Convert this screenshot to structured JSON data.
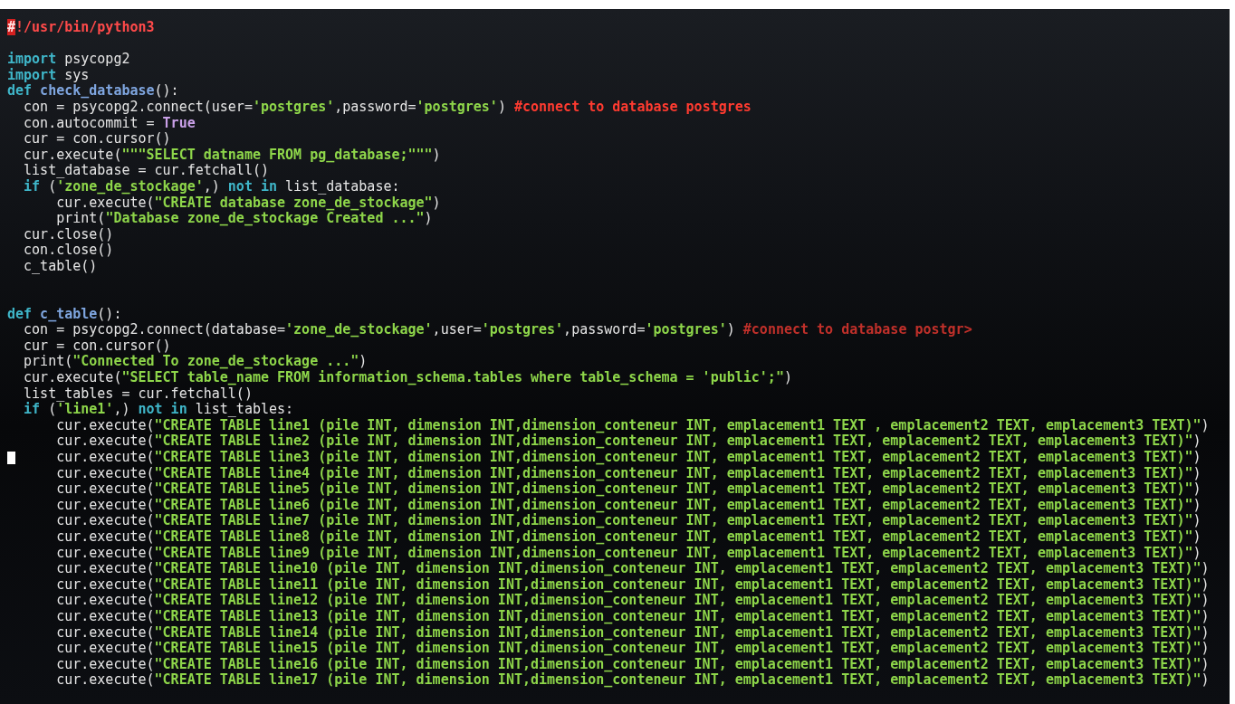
{
  "editor": {
    "lines": [
      {
        "kind": "code",
        "cursor": false,
        "segments": [
          {
            "kind": "mark",
            "t": "#"
          },
          {
            "kind": "shebang",
            "t": "!/usr/bin/python3"
          }
        ]
      },
      {
        "kind": "blank",
        "cursor": false
      },
      {
        "kind": "code",
        "cursor": false,
        "segments": [
          {
            "kind": "kw",
            "t": "import"
          },
          {
            "kind": "plain",
            "t": " psycopg2"
          }
        ]
      },
      {
        "kind": "code",
        "cursor": false,
        "segments": [
          {
            "kind": "kw",
            "t": "import"
          },
          {
            "kind": "plain",
            "t": " sys"
          }
        ]
      },
      {
        "kind": "code",
        "cursor": false,
        "segments": [
          {
            "kind": "kw",
            "t": "def"
          },
          {
            "kind": "fn",
            "t": " check_database"
          },
          {
            "kind": "plain",
            "t": "():"
          }
        ]
      },
      {
        "kind": "code",
        "cursor": false,
        "segments": [
          {
            "kind": "plain",
            "t": "  con = psycopg2.connect(user="
          },
          {
            "kind": "str",
            "t": "'postgres'"
          },
          {
            "kind": "plain",
            "t": ",password="
          },
          {
            "kind": "str",
            "t": "'postgres'"
          },
          {
            "kind": "plain",
            "t": ") "
          },
          {
            "kind": "comment",
            "t": "#connect to database postgres"
          }
        ]
      },
      {
        "kind": "code",
        "cursor": false,
        "segments": [
          {
            "kind": "plain",
            "t": "  con.autocommit = "
          },
          {
            "kind": "const",
            "t": "True"
          }
        ]
      },
      {
        "kind": "code",
        "cursor": false,
        "segments": [
          {
            "kind": "plain",
            "t": "  cur = con.cursor()"
          }
        ]
      },
      {
        "kind": "code",
        "cursor": false,
        "segments": [
          {
            "kind": "plain",
            "t": "  cur.execute("
          },
          {
            "kind": "str",
            "t": "\"\"\"SELECT datname FROM pg_database;\"\"\""
          },
          {
            "kind": "plain",
            "t": ")"
          }
        ]
      },
      {
        "kind": "code",
        "cursor": false,
        "segments": [
          {
            "kind": "plain",
            "t": "  list_database = cur.fetchall()"
          }
        ]
      },
      {
        "kind": "code",
        "cursor": false,
        "segments": [
          {
            "kind": "kw",
            "t": "  if"
          },
          {
            "kind": "plain",
            "t": " ("
          },
          {
            "kind": "str",
            "t": "'zone_de_stockage'"
          },
          {
            "kind": "plain",
            "t": ",) "
          },
          {
            "kind": "kw",
            "t": "not in"
          },
          {
            "kind": "plain",
            "t": " list_database:"
          }
        ]
      },
      {
        "kind": "code",
        "cursor": false,
        "segments": [
          {
            "kind": "plain",
            "t": "      cur.execute("
          },
          {
            "kind": "str",
            "t": "\"CREATE database zone_de_stockage\""
          },
          {
            "kind": "plain",
            "t": ")"
          }
        ]
      },
      {
        "kind": "code",
        "cursor": false,
        "segments": [
          {
            "kind": "plain",
            "t": "      print("
          },
          {
            "kind": "str",
            "t": "\"Database zone_de_stockage Created ...\""
          },
          {
            "kind": "plain",
            "t": ")"
          }
        ]
      },
      {
        "kind": "code",
        "cursor": false,
        "segments": [
          {
            "kind": "plain",
            "t": "  cur.close()"
          }
        ]
      },
      {
        "kind": "code",
        "cursor": false,
        "segments": [
          {
            "kind": "plain",
            "t": "  con.close()"
          }
        ]
      },
      {
        "kind": "code",
        "cursor": false,
        "segments": [
          {
            "kind": "plain",
            "t": "  c_table()"
          }
        ]
      },
      {
        "kind": "blank",
        "cursor": false
      },
      {
        "kind": "blank",
        "cursor": false
      },
      {
        "kind": "code",
        "cursor": false,
        "segments": [
          {
            "kind": "kw",
            "t": "def"
          },
          {
            "kind": "fn",
            "t": " c_table"
          },
          {
            "kind": "plain",
            "t": "():"
          }
        ]
      },
      {
        "kind": "code",
        "cursor": false,
        "segments": [
          {
            "kind": "plain",
            "t": "  con = psycopg2.connect(database="
          },
          {
            "kind": "str",
            "t": "'zone_de_stockage'"
          },
          {
            "kind": "plain",
            "t": ",user="
          },
          {
            "kind": "str",
            "t": "'postgres'"
          },
          {
            "kind": "plain",
            "t": ",password="
          },
          {
            "kind": "str",
            "t": "'postgres'"
          },
          {
            "kind": "plain",
            "t": ") "
          },
          {
            "kind": "comment2",
            "t": "#connect to database postgr>"
          }
        ]
      },
      {
        "kind": "code",
        "cursor": false,
        "segments": [
          {
            "kind": "plain",
            "t": "  cur = con.cursor()"
          }
        ]
      },
      {
        "kind": "code",
        "cursor": false,
        "segments": [
          {
            "kind": "plain",
            "t": "  print("
          },
          {
            "kind": "str",
            "t": "\"Connected To zone_de_stockage ...\""
          },
          {
            "kind": "plain",
            "t": ")"
          }
        ]
      },
      {
        "kind": "code",
        "cursor": false,
        "segments": [
          {
            "kind": "plain",
            "t": "  cur.execute("
          },
          {
            "kind": "str",
            "t": "\"SELECT table_name FROM information_schema.tables where table_schema = 'public';\""
          },
          {
            "kind": "plain",
            "t": ")"
          }
        ]
      },
      {
        "kind": "code",
        "cursor": false,
        "segments": [
          {
            "kind": "plain",
            "t": "  list_tables = cur.fetchall()"
          }
        ]
      },
      {
        "kind": "code",
        "cursor": false,
        "segments": [
          {
            "kind": "kw",
            "t": "  if"
          },
          {
            "kind": "plain",
            "t": " ("
          },
          {
            "kind": "str",
            "t": "'line1'"
          },
          {
            "kind": "plain",
            "t": ",) "
          },
          {
            "kind": "kw",
            "t": "not in"
          },
          {
            "kind": "plain",
            "t": " list_tables:"
          }
        ]
      },
      {
        "kind": "code",
        "cursor": false,
        "segments": [
          {
            "kind": "plain",
            "t": "      cur.execute("
          },
          {
            "kind": "str",
            "t": "\"CREATE TABLE line1 (pile INT, dimension INT,dimension_conteneur INT, emplacement1 TEXT , emplacement2 TEXT, emplacement3 TEXT)\""
          },
          {
            "kind": "plain",
            "t": ")"
          }
        ]
      },
      {
        "kind": "code",
        "cursor": false,
        "segments": [
          {
            "kind": "plain",
            "t": "      cur.execute("
          },
          {
            "kind": "str",
            "t": "\"CREATE TABLE line2 (pile INT, dimension INT,dimension_conteneur INT, emplacement1 TEXT, emplacement2 TEXT, emplacement3 TEXT)\""
          },
          {
            "kind": "plain",
            "t": ")"
          }
        ]
      },
      {
        "kind": "code",
        "cursor": true,
        "segments": [
          {
            "kind": "plain",
            "t": "      cur.execute("
          },
          {
            "kind": "str",
            "t": "\"CREATE TABLE line3 (pile INT, dimension INT,dimension_conteneur INT, emplacement1 TEXT, emplacement2 TEXT, emplacement3 TEXT)\""
          },
          {
            "kind": "plain",
            "t": ")"
          }
        ]
      },
      {
        "kind": "code",
        "cursor": false,
        "segments": [
          {
            "kind": "plain",
            "t": "      cur.execute("
          },
          {
            "kind": "str",
            "t": "\"CREATE TABLE line4 (pile INT, dimension INT,dimension_conteneur INT, emplacement1 TEXT, emplacement2 TEXT, emplacement3 TEXT)\""
          },
          {
            "kind": "plain",
            "t": ")"
          }
        ]
      },
      {
        "kind": "code",
        "cursor": false,
        "segments": [
          {
            "kind": "plain",
            "t": "      cur.execute("
          },
          {
            "kind": "str",
            "t": "\"CREATE TABLE line5 (pile INT, dimension INT,dimension_conteneur INT, emplacement1 TEXT, emplacement2 TEXT, emplacement3 TEXT)\""
          },
          {
            "kind": "plain",
            "t": ")"
          }
        ]
      },
      {
        "kind": "code",
        "cursor": false,
        "segments": [
          {
            "kind": "plain",
            "t": "      cur.execute("
          },
          {
            "kind": "str",
            "t": "\"CREATE TABLE line6 (pile INT, dimension INT,dimension_conteneur INT, emplacement1 TEXT, emplacement2 TEXT, emplacement3 TEXT)\""
          },
          {
            "kind": "plain",
            "t": ")"
          }
        ]
      },
      {
        "kind": "code",
        "cursor": false,
        "segments": [
          {
            "kind": "plain",
            "t": "      cur.execute("
          },
          {
            "kind": "str",
            "t": "\"CREATE TABLE line7 (pile INT, dimension INT,dimension_conteneur INT, emplacement1 TEXT, emplacement2 TEXT, emplacement3 TEXT)\""
          },
          {
            "kind": "plain",
            "t": ")"
          }
        ]
      },
      {
        "kind": "code",
        "cursor": false,
        "segments": [
          {
            "kind": "plain",
            "t": "      cur.execute("
          },
          {
            "kind": "str",
            "t": "\"CREATE TABLE line8 (pile INT, dimension INT,dimension_conteneur INT, emplacement1 TEXT, emplacement2 TEXT, emplacement3 TEXT)\""
          },
          {
            "kind": "plain",
            "t": ")"
          }
        ]
      },
      {
        "kind": "code",
        "cursor": false,
        "segments": [
          {
            "kind": "plain",
            "t": "      cur.execute("
          },
          {
            "kind": "str",
            "t": "\"CREATE TABLE line9 (pile INT, dimension INT,dimension_conteneur INT, emplacement1 TEXT, emplacement2 TEXT, emplacement3 TEXT)\""
          },
          {
            "kind": "plain",
            "t": ")"
          }
        ]
      },
      {
        "kind": "code",
        "cursor": false,
        "segments": [
          {
            "kind": "plain",
            "t": "      cur.execute("
          },
          {
            "kind": "str",
            "t": "\"CREATE TABLE line10 (pile INT, dimension INT,dimension_conteneur INT, emplacement1 TEXT, emplacement2 TEXT, emplacement3 TEXT)\""
          },
          {
            "kind": "plain",
            "t": ")"
          }
        ]
      },
      {
        "kind": "code",
        "cursor": false,
        "segments": [
          {
            "kind": "plain",
            "t": "      cur.execute("
          },
          {
            "kind": "str",
            "t": "\"CREATE TABLE line11 (pile INT, dimension INT,dimension_conteneur INT, emplacement1 TEXT, emplacement2 TEXT, emplacement3 TEXT)\""
          },
          {
            "kind": "plain",
            "t": ")"
          }
        ]
      },
      {
        "kind": "code",
        "cursor": false,
        "segments": [
          {
            "kind": "plain",
            "t": "      cur.execute("
          },
          {
            "kind": "str",
            "t": "\"CREATE TABLE line12 (pile INT, dimension INT,dimension_conteneur INT, emplacement1 TEXT, emplacement2 TEXT, emplacement3 TEXT)\""
          },
          {
            "kind": "plain",
            "t": ")"
          }
        ]
      },
      {
        "kind": "code",
        "cursor": false,
        "segments": [
          {
            "kind": "plain",
            "t": "      cur.execute("
          },
          {
            "kind": "str",
            "t": "\"CREATE TABLE line13 (pile INT, dimension INT,dimension_conteneur INT, emplacement1 TEXT, emplacement2 TEXT, emplacement3 TEXT)\""
          },
          {
            "kind": "plain",
            "t": ")"
          }
        ]
      },
      {
        "kind": "code",
        "cursor": false,
        "segments": [
          {
            "kind": "plain",
            "t": "      cur.execute("
          },
          {
            "kind": "str",
            "t": "\"CREATE TABLE line14 (pile INT, dimension INT,dimension_conteneur INT, emplacement1 TEXT, emplacement2 TEXT, emplacement3 TEXT)\""
          },
          {
            "kind": "plain",
            "t": ")"
          }
        ]
      },
      {
        "kind": "code",
        "cursor": false,
        "segments": [
          {
            "kind": "plain",
            "t": "      cur.execute("
          },
          {
            "kind": "str",
            "t": "\"CREATE TABLE line15 (pile INT, dimension INT,dimension_conteneur INT, emplacement1 TEXT, emplacement2 TEXT, emplacement3 TEXT)\""
          },
          {
            "kind": "plain",
            "t": ")"
          }
        ]
      },
      {
        "kind": "code",
        "cursor": false,
        "segments": [
          {
            "kind": "plain",
            "t": "      cur.execute("
          },
          {
            "kind": "str",
            "t": "\"CREATE TABLE line16 (pile INT, dimension INT,dimension_conteneur INT, emplacement1 TEXT, emplacement2 TEXT, emplacement3 TEXT)\""
          },
          {
            "kind": "plain",
            "t": ")"
          }
        ]
      },
      {
        "kind": "code",
        "cursor": false,
        "segments": [
          {
            "kind": "plain",
            "t": "      cur.execute("
          },
          {
            "kind": "str",
            "t": "\"CREATE TABLE line17 (pile INT, dimension INT,dimension_conteneur INT, emplacement1 TEXT, emplacement2 TEXT, emplacement3 TEXT)\""
          },
          {
            "kind": "plain",
            "t": ")"
          }
        ]
      }
    ]
  }
}
